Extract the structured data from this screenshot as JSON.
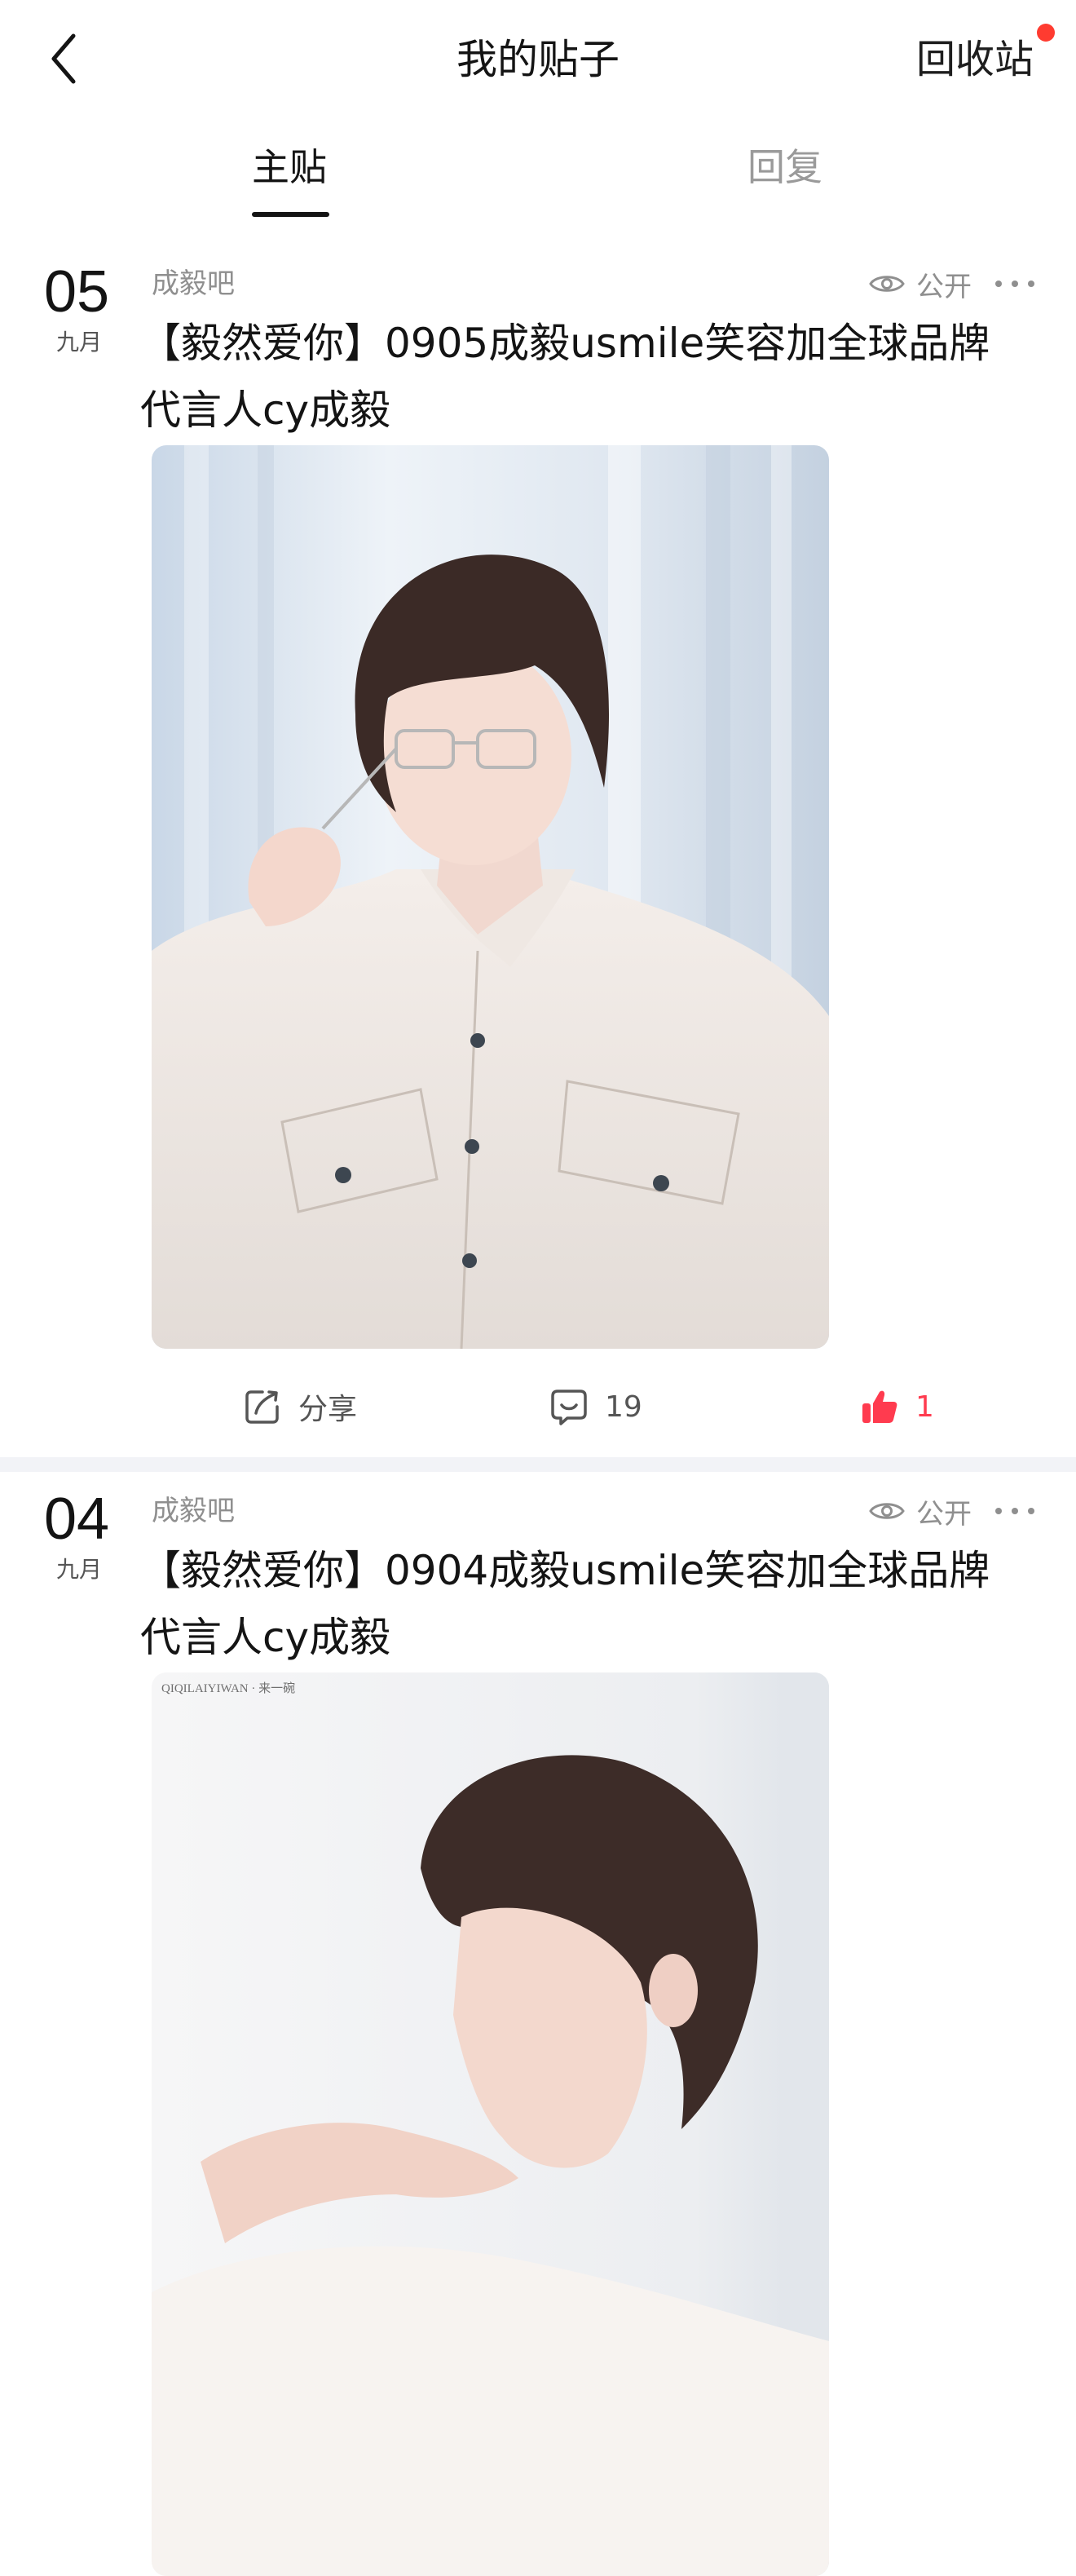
{
  "header": {
    "title": "我的贴子",
    "recycle_label": "回收站",
    "notification_color": "#ff3b30"
  },
  "tabs": [
    {
      "label": "主贴",
      "active": true
    },
    {
      "label": "回复",
      "active": false
    }
  ],
  "posts": [
    {
      "day": "05",
      "month": "九月",
      "forum": "成毅吧",
      "visibility": "公开",
      "title": "【毅然爱你】0905成毅usmile笑容加全球品牌代言人cy成毅",
      "share_label": "分享",
      "comments": "19",
      "likes": "1"
    },
    {
      "day": "04",
      "month": "九月",
      "forum": "成毅吧",
      "visibility": "公开",
      "title": "【毅然爱你】0904成毅usmile笑容加全球品牌代言人cy成毅",
      "image_caption": "QIQILAIYIWAN · 来一碗"
    }
  ],
  "colors": {
    "accent_like": "#ff3b4f",
    "separator": "#f2f3f7",
    "muted_text": "#8f8f8f"
  }
}
